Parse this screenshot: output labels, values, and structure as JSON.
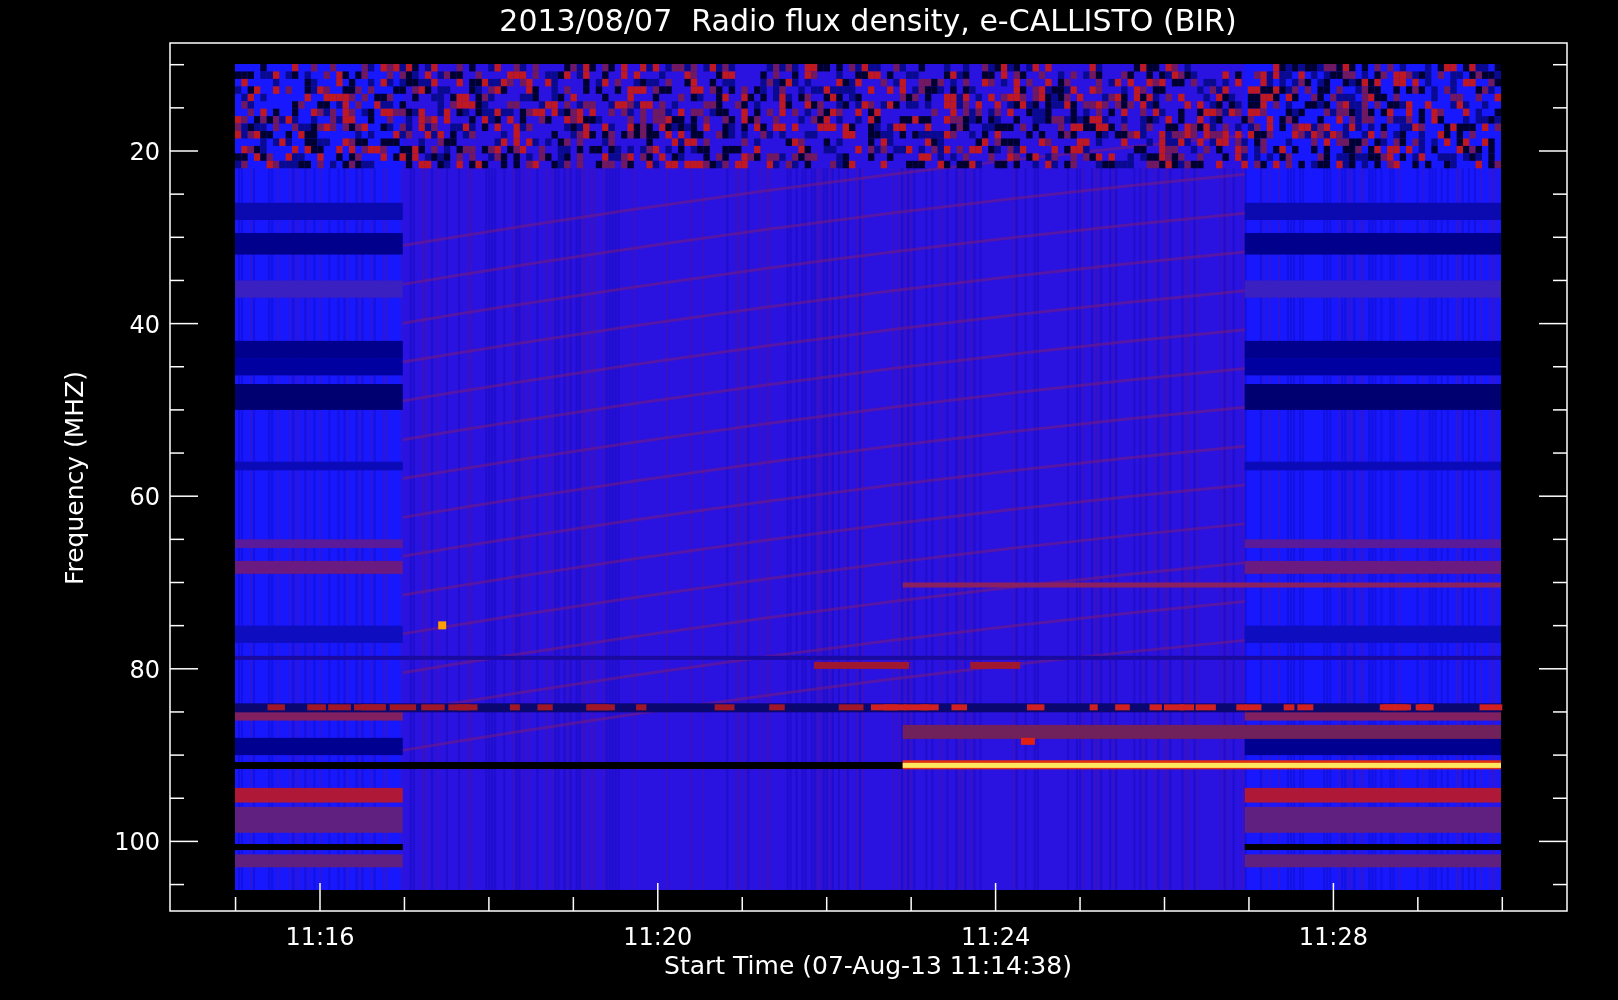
{
  "title": "2013/08/07  Radio flux density, e-CALLISTO (BIR)",
  "y_axis": {
    "label": "Frequency (MHZ)",
    "ticks": [
      "20",
      "40",
      "60",
      "80",
      "100"
    ]
  },
  "x_axis": {
    "label": "Start Time (07-Aug-13 11:14:38)",
    "ticks": [
      "11:16",
      "11:20",
      "11:24",
      "11:28"
    ]
  }
}
